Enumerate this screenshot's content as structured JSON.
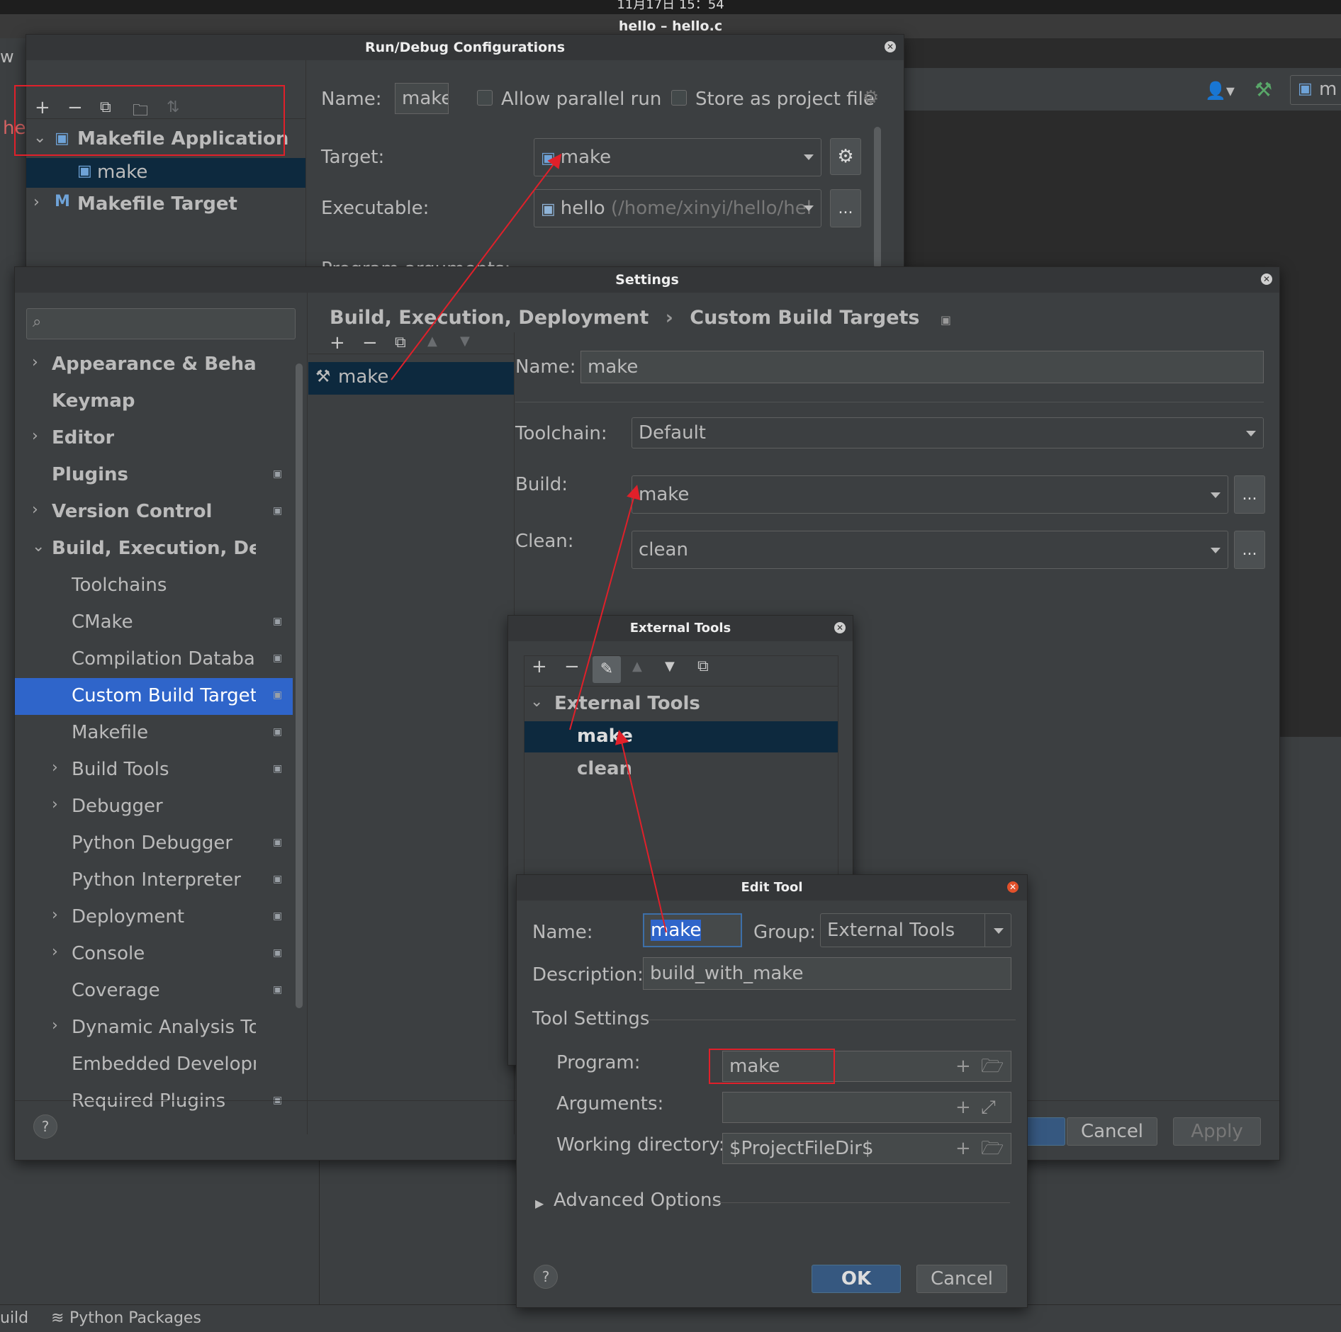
{
  "system": {
    "clock": "11月17日 15：54",
    "window_title": "hello – hello.c"
  },
  "ide": {
    "left_edge_text": "w",
    "tab_text": "he",
    "toolbar_config": "m",
    "statusbar": {
      "build": "uild",
      "python_packages": "Python Packages"
    }
  },
  "run_debug": {
    "title": "Run/Debug Configurations",
    "tree": [
      {
        "label": "Makefile Application",
        "expanded": true
      },
      {
        "label": "make",
        "selected": true
      },
      {
        "label": "Makefile Target",
        "expanded": false
      }
    ],
    "name_label": "Name:",
    "name_value": "make",
    "allow_parallel_run": "Allow parallel run",
    "store_as_project_file": "Store as project file",
    "target_label": "Target:",
    "target_value": "make",
    "executable_label": "Executable:",
    "executable_name": "hello",
    "executable_path": "(/home/xinyi/hello/hel",
    "more_button": "...",
    "program_args_label": "Program arguments:"
  },
  "settings": {
    "title": "Settings",
    "search_placeholder": "",
    "nav": [
      {
        "label": "Appearance & Behavior",
        "level": 0,
        "arrow": "right",
        "icon": false
      },
      {
        "label": "Keymap",
        "level": 0,
        "arrow": "none",
        "icon": false
      },
      {
        "label": "Editor",
        "level": 0,
        "arrow": "right",
        "icon": false
      },
      {
        "label": "Plugins",
        "level": 0,
        "arrow": "none",
        "icon": true
      },
      {
        "label": "Version Control",
        "level": 0,
        "arrow": "right",
        "icon": true
      },
      {
        "label": "Build, Execution, Deploym",
        "level": 0,
        "arrow": "down",
        "icon": false
      },
      {
        "label": "Toolchains",
        "level": 1,
        "arrow": "none",
        "icon": false
      },
      {
        "label": "CMake",
        "level": 1,
        "arrow": "none",
        "icon": true
      },
      {
        "label": "Compilation Database",
        "level": 1,
        "arrow": "none",
        "icon": true
      },
      {
        "label": "Custom Build Targets",
        "level": 1,
        "arrow": "none",
        "icon": true,
        "selected": true
      },
      {
        "label": "Makefile",
        "level": 1,
        "arrow": "none",
        "icon": true
      },
      {
        "label": "Build Tools",
        "level": 1,
        "arrow": "right",
        "icon": true
      },
      {
        "label": "Debugger",
        "level": 1,
        "arrow": "right",
        "icon": false
      },
      {
        "label": "Python Debugger",
        "level": 1,
        "arrow": "none",
        "icon": true
      },
      {
        "label": "Python Interpreter",
        "level": 1,
        "arrow": "none",
        "icon": true
      },
      {
        "label": "Deployment",
        "level": 1,
        "arrow": "right",
        "icon": true
      },
      {
        "label": "Console",
        "level": 1,
        "arrow": "right",
        "icon": true
      },
      {
        "label": "Coverage",
        "level": 1,
        "arrow": "none",
        "icon": true
      },
      {
        "label": "Dynamic Analysis Tools",
        "level": 1,
        "arrow": "right",
        "icon": false
      },
      {
        "label": "Embedded Development",
        "level": 1,
        "arrow": "none",
        "icon": false
      },
      {
        "label": "Required Plugins",
        "level": 1,
        "arrow": "none",
        "icon": true
      }
    ],
    "breadcrumb": {
      "parent": "Build, Execution, Deployment",
      "separator": "›",
      "current": "Custom Build Targets"
    },
    "targets": [
      {
        "label": "make",
        "selected": true
      }
    ],
    "name_label": "Name:",
    "name_value": "make",
    "toolchain_label": "Toolchain:",
    "toolchain_value": "Default",
    "build_label": "Build:",
    "build_value": "make",
    "clean_label": "Clean:",
    "clean_value": "clean",
    "more_button": "...",
    "help": "?",
    "cancel": "Cancel",
    "apply": "Apply"
  },
  "external_tools": {
    "title": "External Tools",
    "group": "External Tools",
    "items": [
      {
        "label": "make",
        "selected": true
      },
      {
        "label": "clean",
        "selected": false
      }
    ]
  },
  "edit_tool": {
    "title": "Edit Tool",
    "name_label": "Name:",
    "name_value": "make",
    "group_label": "Group:",
    "group_value": "External Tools",
    "description_label": "Description:",
    "description_value": "build_with_make",
    "tool_settings": "Tool Settings",
    "program_label": "Program:",
    "program_value": "make",
    "arguments_label": "Arguments:",
    "arguments_value": "",
    "working_dir_label": "Working directory:",
    "working_dir_value": "$ProjectFileDir$",
    "advanced_options": "Advanced Options",
    "help": "?",
    "ok": "OK",
    "cancel": "Cancel"
  },
  "colors": {
    "accent": "#2f65ca",
    "selection_dark": "#0d293e",
    "annotation_red": "#e0202a"
  }
}
